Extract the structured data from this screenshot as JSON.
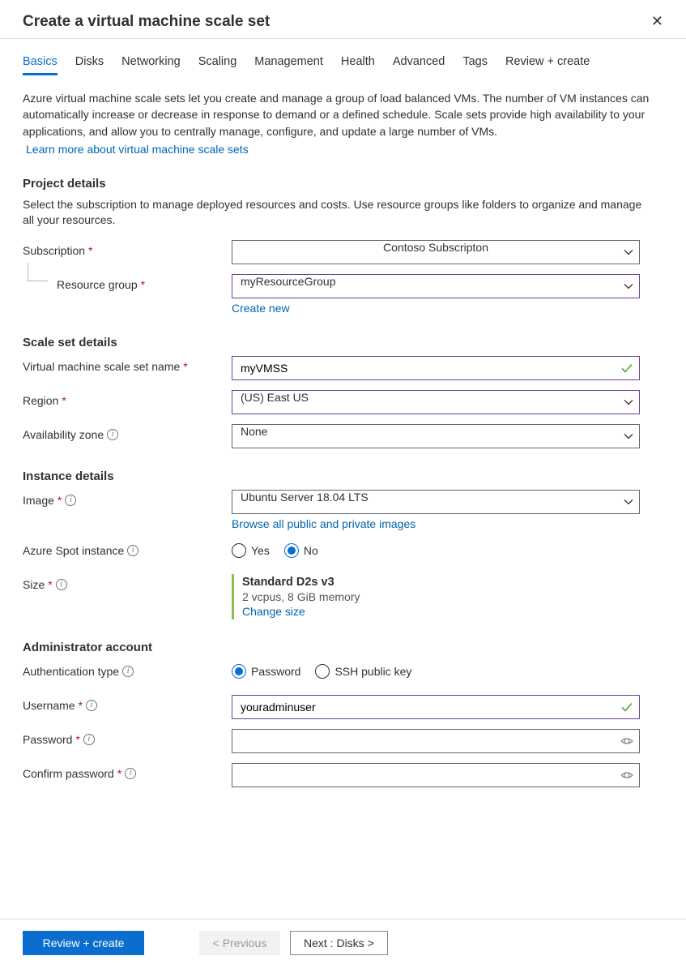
{
  "header": {
    "title": "Create a virtual machine scale set"
  },
  "tabs": [
    "Basics",
    "Disks",
    "Networking",
    "Scaling",
    "Management",
    "Health",
    "Advanced",
    "Tags",
    "Review + create"
  ],
  "intro": "Azure virtual machine scale sets let you create and manage a group of load balanced VMs. The number of VM instances can automatically increase or decrease in response to demand or a defined schedule. Scale sets provide high availability to your applications, and allow you to centrally manage, configure, and update a large number of VMs.",
  "intro_link": "Learn more about virtual machine scale sets",
  "project": {
    "title": "Project details",
    "desc": "Select the subscription to manage deployed resources and costs. Use resource groups like folders to organize and manage all your resources.",
    "subscription_label": "Subscription",
    "subscription_value": "Contoso Subscripton",
    "rg_label": "Resource group",
    "rg_value": "myResourceGroup",
    "create_new": "Create new"
  },
  "scaleset": {
    "title": "Scale set details",
    "name_label": "Virtual machine scale set name",
    "name_value": "myVMSS",
    "region_label": "Region",
    "region_value": "(US) East US",
    "az_label": "Availability zone",
    "az_value": "None"
  },
  "instance": {
    "title": "Instance details",
    "image_label": "Image",
    "image_value": "Ubuntu Server 18.04 LTS",
    "browse_link": "Browse all public and private images",
    "spot_label": "Azure Spot instance",
    "spot_yes": "Yes",
    "spot_no": "No",
    "size_label": "Size",
    "size_name": "Standard D2s v3",
    "size_sub": "2 vcpus, 8 GiB memory",
    "change_size": "Change size"
  },
  "admin": {
    "title": "Administrator account",
    "auth_label": "Authentication type",
    "auth_password": "Password",
    "auth_ssh": "SSH public key",
    "user_label": "Username",
    "user_value": "youradminuser",
    "pw_label": "Password",
    "cpw_label": "Confirm password"
  },
  "footer": {
    "review": "Review + create",
    "prev": "< Previous",
    "next": "Next : Disks >"
  }
}
